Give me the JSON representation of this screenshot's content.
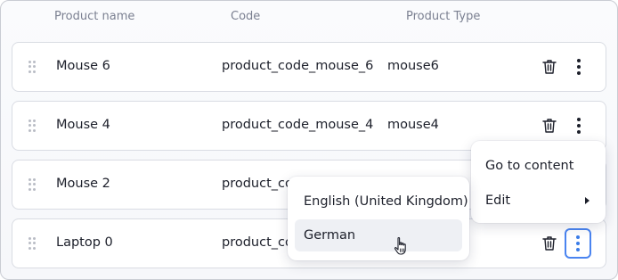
{
  "columns": {
    "product_name": "Product name",
    "code": "Code",
    "product_type": "Product Type"
  },
  "rows": [
    {
      "name": "Mouse 6",
      "code": "product_code_mouse_6",
      "type": "mouse6"
    },
    {
      "name": "Mouse 4",
      "code": "product_code_mouse_4",
      "type": "mouse4"
    },
    {
      "name": "Mouse 2",
      "code": "product_co",
      "type": ""
    },
    {
      "name": "Laptop 0",
      "code": "product_co",
      "type": ""
    }
  ],
  "row_actions_menu": {
    "items": [
      {
        "label": "Go to content"
      },
      {
        "label": "Edit"
      }
    ]
  },
  "language_submenu": {
    "items": [
      {
        "label": "English (United Kingdom)"
      },
      {
        "label": "German"
      }
    ]
  },
  "icons": {
    "drag": "drag-handle-icon",
    "delete": "trash-icon",
    "more": "more-vertical-icon",
    "submenu": "chevron-right-icon",
    "cursor": "hand-pointer-icon"
  },
  "colors": {
    "accent": "#3a7ce8",
    "text": "#1c1f2a",
    "muted": "#7b8091",
    "border": "#d9dce3"
  }
}
